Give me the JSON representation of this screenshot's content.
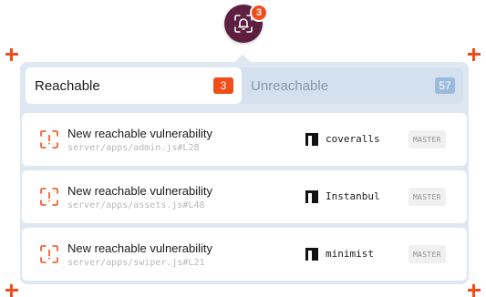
{
  "notification": {
    "count": "3",
    "icon": "bell-scan-icon"
  },
  "tabs": [
    {
      "label": "Reachable",
      "count": "3",
      "active": true
    },
    {
      "label": "Unreachable",
      "count": "57",
      "active": false
    }
  ],
  "items": [
    {
      "title": "New reachable vulnerability",
      "path": "server/apps/admin.js#L28",
      "package": "coveralls",
      "branch": "MASTER",
      "icon": "alert-scan-icon",
      "package_icon": "npm-icon"
    },
    {
      "title": "New reachable vulnerability",
      "path": "server/apps/assets.js#L48",
      "package": "Instanbul",
      "branch": "MASTER",
      "icon": "alert-scan-icon",
      "package_icon": "npm-icon"
    },
    {
      "title": "New reachable vulnerability",
      "path": "server/apps/swiper.js#L21",
      "package": "minimist",
      "branch": "MASTER",
      "icon": "alert-scan-icon",
      "package_icon": "npm-icon"
    }
  ],
  "colors": {
    "accent": "#f04d1a",
    "bell_bg": "#5c1f3f",
    "panel_bg": "#dfe8f2"
  }
}
